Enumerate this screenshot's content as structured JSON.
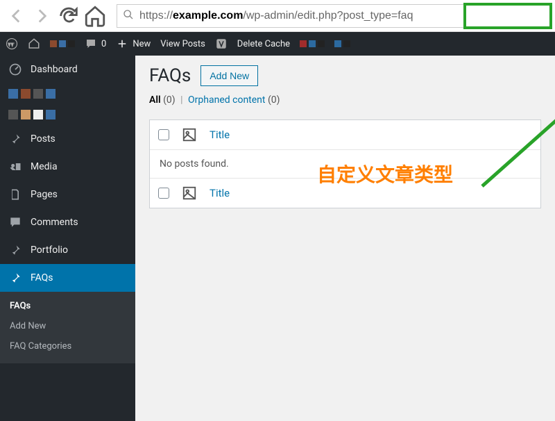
{
  "browser": {
    "url_prefix": "https://",
    "url_domain": "example.com",
    "url_path": "/wp-admin/edit.php",
    "url_query": "?post_type=faq"
  },
  "adminbar": {
    "comment_count": "0",
    "new_label": "New",
    "view_posts": "View Posts",
    "delete_cache": "Delete Cache"
  },
  "sidebar": {
    "items": [
      {
        "label": "Dashboard"
      },
      {
        "label": "Posts"
      },
      {
        "label": "Media"
      },
      {
        "label": "Pages"
      },
      {
        "label": "Comments"
      },
      {
        "label": "Portfolio"
      },
      {
        "label": "FAQs"
      }
    ],
    "faqs_sub": {
      "all": "FAQs",
      "add_new": "Add New",
      "cats": "FAQ Categories"
    }
  },
  "content": {
    "heading": "FAQs",
    "add_new": "Add New",
    "filters": {
      "all_label": "All",
      "all_count": "(0)",
      "orphaned_label": "Orphaned content",
      "orphaned_count": "(0)"
    },
    "table": {
      "title_col": "Title",
      "no_posts": "No posts found."
    }
  },
  "annotation": {
    "text": "自定义文章类型"
  }
}
